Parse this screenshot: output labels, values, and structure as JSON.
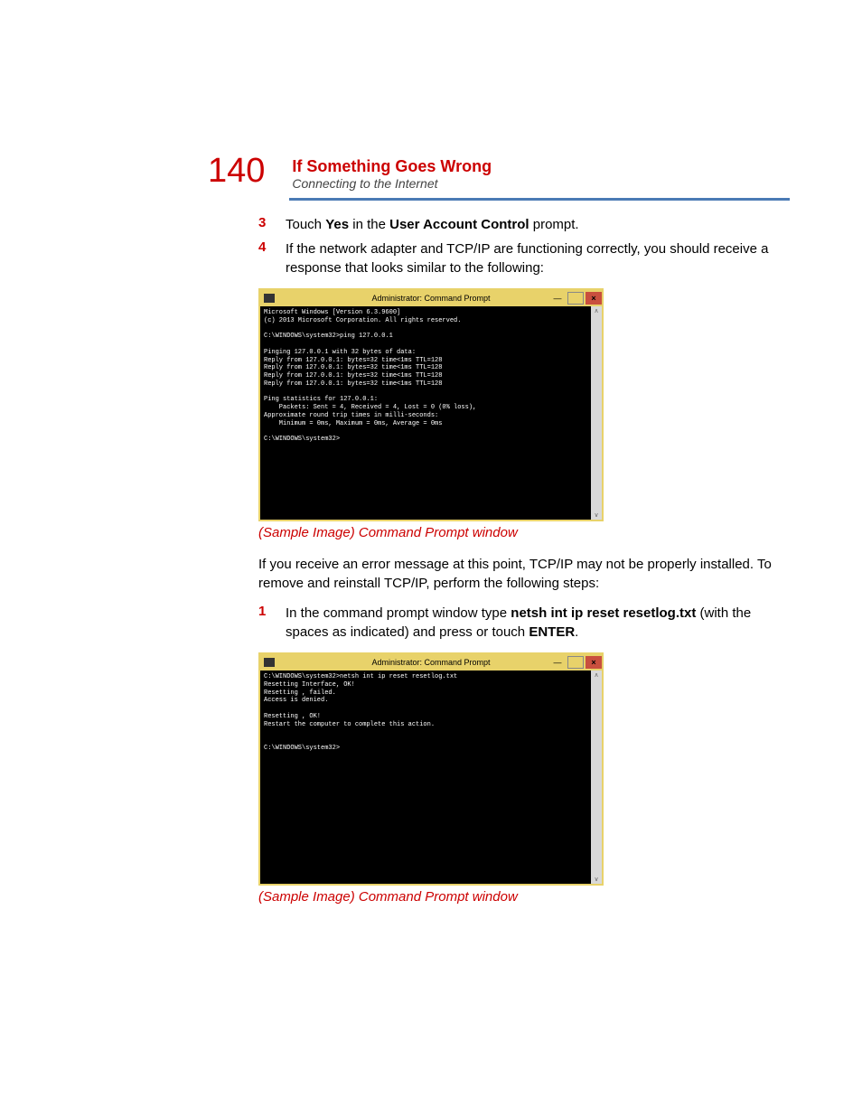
{
  "header": {
    "page_number": "140",
    "title": "If Something Goes Wrong",
    "subtitle": "Connecting to the Internet"
  },
  "steps_a": [
    {
      "num": "3",
      "pre": "Touch ",
      "b1": "Yes",
      "mid": " in the ",
      "b2": "User Account Control",
      "post": " prompt."
    },
    {
      "num": "4",
      "text": "If the network adapter and TCP/IP are functioning correctly, you should receive a response that looks similar to the following:"
    }
  ],
  "cmd1": {
    "title": "Administrator: Command Prompt",
    "body": "Microsoft Windows [Version 6.3.9600]\n(c) 2013 Microsoft Corporation. All rights reserved.\n\nC:\\WINDOWS\\system32>ping 127.0.0.1\n\nPinging 127.0.0.1 with 32 bytes of data:\nReply from 127.0.0.1: bytes=32 time<1ms TTL=128\nReply from 127.0.0.1: bytes=32 time<1ms TTL=128\nReply from 127.0.0.1: bytes=32 time<1ms TTL=128\nReply from 127.0.0.1: bytes=32 time<1ms TTL=128\n\nPing statistics for 127.0.0.1:\n    Packets: Sent = 4, Received = 4, Lost = 0 (0% loss),\nApproximate round trip times in milli-seconds:\n    Minimum = 0ms, Maximum = 0ms, Average = 0ms\n\nC:\\WINDOWS\\system32>"
  },
  "caption1": "(Sample Image) Command Prompt window",
  "para1": "If you receive an error message at this point, TCP/IP may not be properly installed. To remove and reinstall TCP/IP, perform the following steps:",
  "steps_b": [
    {
      "num": "1",
      "pre": "In the command prompt window type ",
      "b1": "netsh int ip reset resetlog.txt",
      "mid": " (with the spaces as indicated) and press or touch ",
      "b2": "ENTER",
      "post": "."
    }
  ],
  "cmd2": {
    "title": "Administrator: Command Prompt",
    "body": "C:\\WINDOWS\\system32>netsh int ip reset resetlog.txt\nResetting Interface, OK!\nResetting , failed.\nAccess is denied.\n\nResetting , OK!\nRestart the computer to complete this action.\n\n\nC:\\WINDOWS\\system32>"
  },
  "caption2": "(Sample Image) Command Prompt window",
  "controls": {
    "min": "—",
    "max": "□",
    "close": "×"
  }
}
